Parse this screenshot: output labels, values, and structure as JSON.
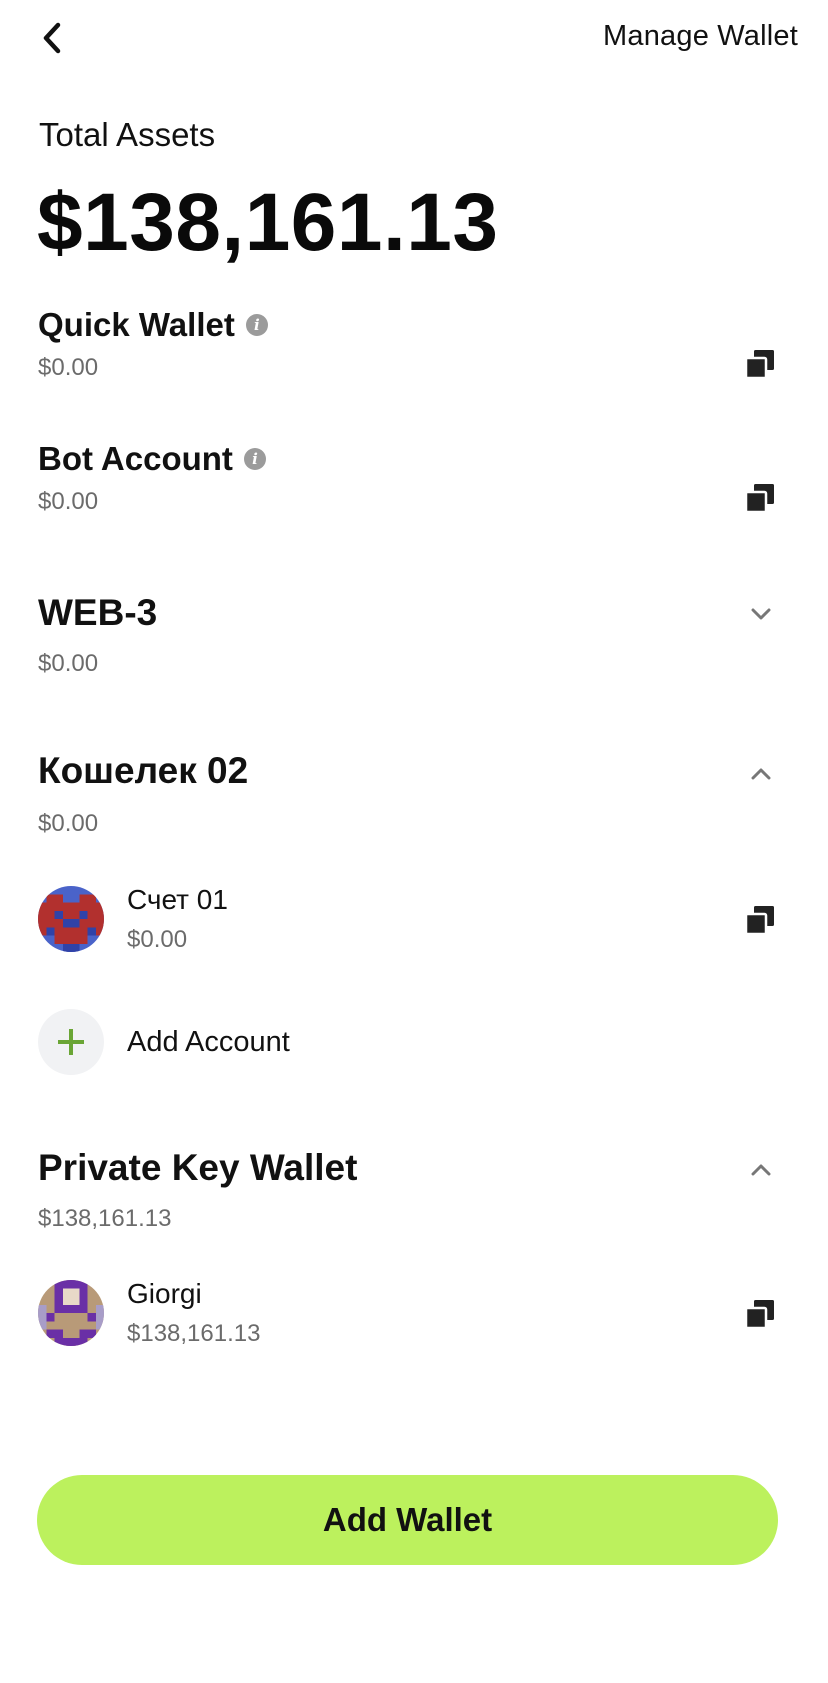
{
  "header": {
    "back_icon": "chevron-left-icon",
    "manage_label": "Manage Wallet"
  },
  "total": {
    "label": "Total Assets",
    "value": "$138,161.13"
  },
  "wallets": [
    {
      "name": "Quick Wallet",
      "balance": "$0.00",
      "has_info": true,
      "action_icon": "copy-icon"
    },
    {
      "name": "Bot Account",
      "balance": "$0.00",
      "has_info": true,
      "action_icon": "copy-icon"
    },
    {
      "name": "WEB-3",
      "balance": "$0.00",
      "expanded": false,
      "action_icon": "chevron-down-icon"
    },
    {
      "name": "Кошелек 02",
      "balance": "$0.00",
      "expanded": true,
      "action_icon": "chevron-up-icon",
      "accounts": [
        {
          "name": "Счет 01",
          "balance": "$0.00",
          "avatar": "pixel-avatar-red-blue"
        }
      ],
      "add_account_label": "Add Account"
    },
    {
      "name": "Private Key Wallet",
      "balance": "$138,161.13",
      "expanded": true,
      "action_icon": "chevron-up-icon",
      "accounts": [
        {
          "name": "Giorgi",
          "balance": "$138,161.13",
          "avatar": "pixel-avatar-purple-tan"
        }
      ]
    }
  ],
  "add_wallet_label": "Add Wallet",
  "colors": {
    "accent": "#bcf15d",
    "plus": "#6aa535",
    "muted_text": "#6b6b6b",
    "icon_dark": "#222222"
  }
}
